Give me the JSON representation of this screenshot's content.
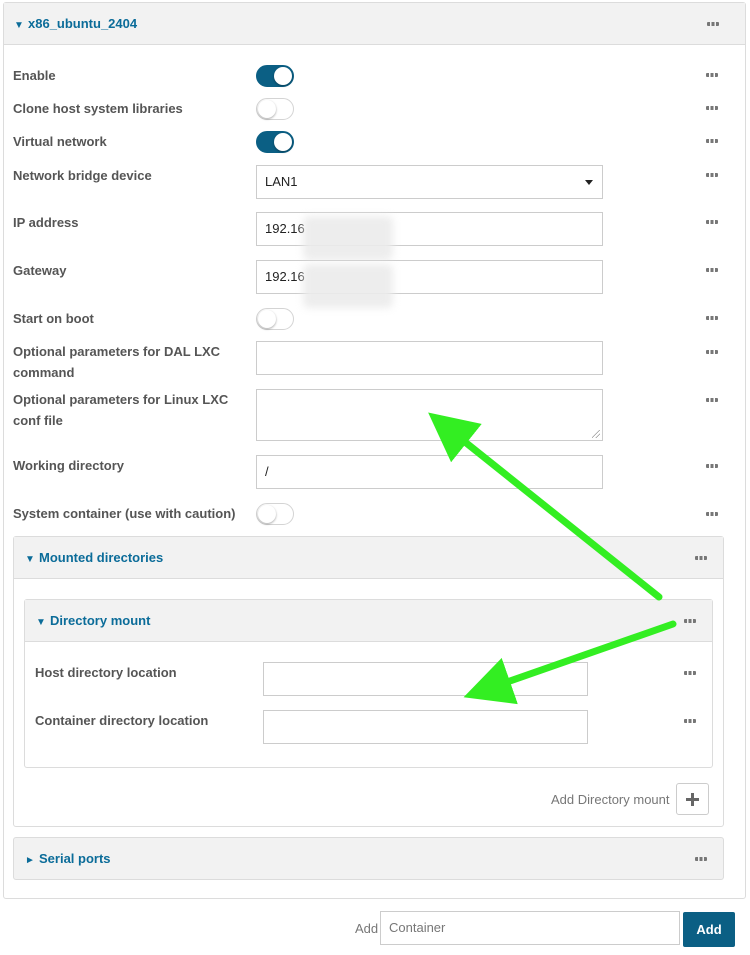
{
  "container": {
    "title": "x86_ubuntu_2404",
    "caret": "▼",
    "fields": {
      "enable": {
        "label": "Enable",
        "value": true
      },
      "clone_libs": {
        "label": "Clone host system libraries",
        "value": false
      },
      "virtual_network": {
        "label": "Virtual network",
        "value": true
      },
      "bridge": {
        "label": "Network bridge device",
        "value": "LAN1"
      },
      "ip": {
        "label": "IP address",
        "value": "192.16"
      },
      "gateway": {
        "label": "Gateway",
        "value": "192.16"
      },
      "start_on_boot": {
        "label": "Start on boot",
        "value": false
      },
      "dal_params": {
        "label_line1": "Optional parameters for DAL LXC",
        "label_line2": "command",
        "value": ""
      },
      "conf_params": {
        "label_line1": "Optional parameters for Linux LXC",
        "label_line2": "conf file",
        "value": ""
      },
      "workdir": {
        "label": "Working directory",
        "value": "/"
      },
      "system_container": {
        "label": "System container (use with caution)",
        "value": false
      }
    }
  },
  "mounted_dirs": {
    "title": "Mounted directories",
    "caret": "▼",
    "mount": {
      "title": "Directory mount",
      "caret": "▼",
      "host_label": "Host directory location",
      "host_value": "",
      "container_label": "Container directory location",
      "container_value": ""
    },
    "add_label": "Add Directory mount"
  },
  "serial_ports": {
    "title": "Serial ports",
    "caret": "►"
  },
  "footer": {
    "add_label": "Add",
    "name_placeholder": "Container",
    "add_button": "Add"
  },
  "annotation": {
    "arrow_color": "#33ee22"
  }
}
